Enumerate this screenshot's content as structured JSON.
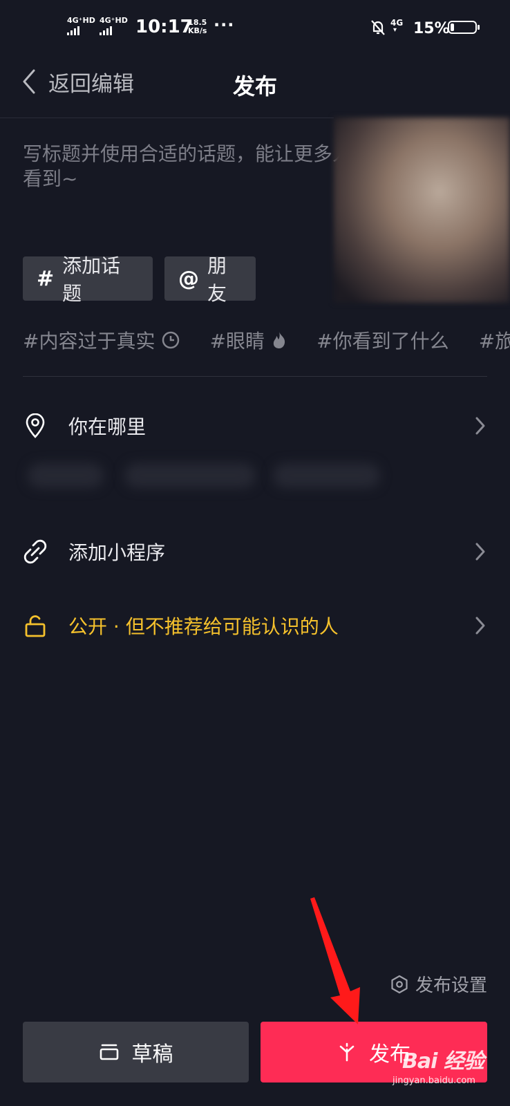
{
  "status_bar": {
    "sim1": "4G⁺HD",
    "sim2": "4G⁺HD",
    "time": "10:17",
    "speed_value": "18.5",
    "speed_unit": "KB/s",
    "more": "···",
    "network": "4G",
    "battery": "15%",
    "battery_level": 0.15
  },
  "header": {
    "back_label": "返回编辑",
    "title": "发布"
  },
  "caption": {
    "placeholder": "写标题并使用合适的话题，能让更多人看到~"
  },
  "chips": {
    "topic_symbol": "#",
    "topic_label": "添加话题",
    "friend_symbol": "@",
    "friend_label": "朋友"
  },
  "trending_tags": [
    {
      "text": "#内容过于真实",
      "icon": "clock-icon"
    },
    {
      "text": "#眼睛",
      "icon": "fire-icon"
    },
    {
      "text": "#你看到了什么",
      "icon": ""
    },
    {
      "text": "#旅",
      "icon": ""
    }
  ],
  "rows": {
    "location_label": "你在哪里",
    "miniapp_label": "添加小程序",
    "privacy_label": "公开 · 但不推荐给可能认识的人"
  },
  "bottom": {
    "settings_label": "发布设置",
    "draft_label": "草稿",
    "publish_label": "发布"
  },
  "watermark": {
    "main": "Bai 经验",
    "sub": "jingyan.baidu.com"
  },
  "colors": {
    "background": "#161823",
    "accent": "#fe2c55",
    "privacy": "#f5c12c",
    "chip": "#393b44"
  }
}
